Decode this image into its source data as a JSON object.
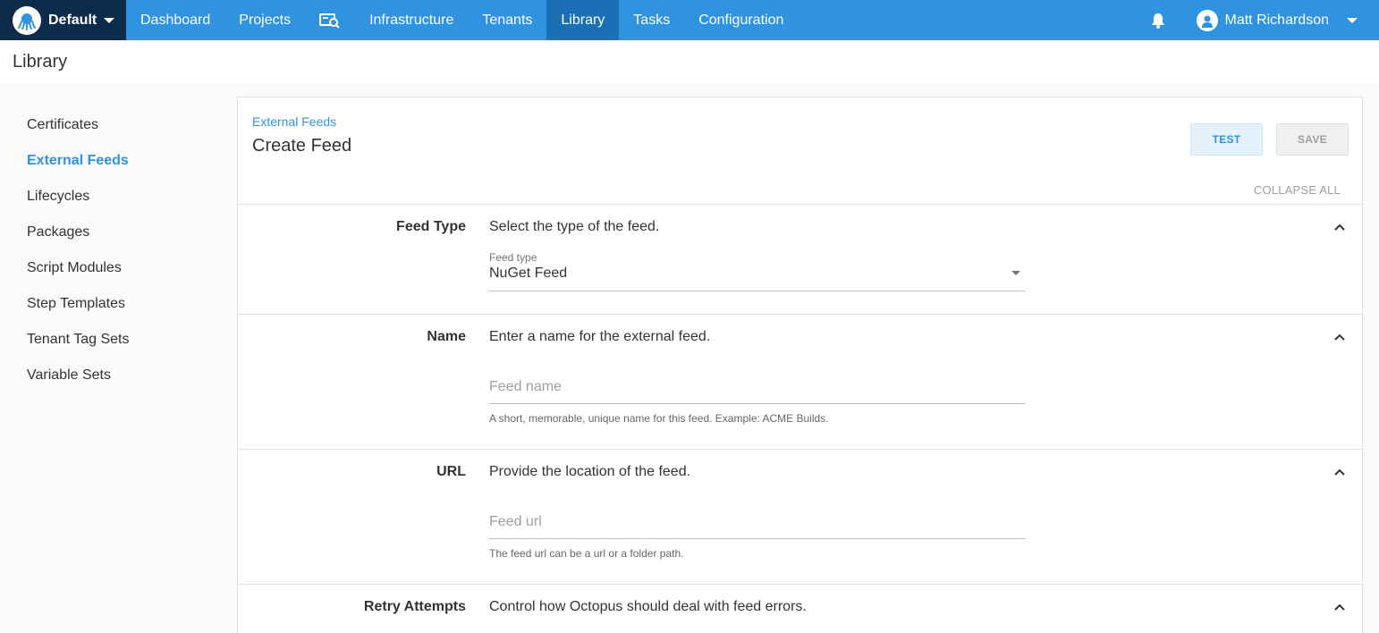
{
  "nav": {
    "space": "Default",
    "items": [
      "Dashboard",
      "Projects",
      "Infrastructure",
      "Tenants",
      "Library",
      "Tasks",
      "Configuration"
    ],
    "active": "Library",
    "user": "Matt Richardson",
    "colors": {
      "bar": "#2f93e0",
      "active": "#1a6fb5",
      "space_bg": "#0d2b4a"
    }
  },
  "page": {
    "title": "Library"
  },
  "sidebar": {
    "items": [
      {
        "label": "Certificates"
      },
      {
        "label": "External Feeds"
      },
      {
        "label": "Lifecycles"
      },
      {
        "label": "Packages"
      },
      {
        "label": "Script Modules"
      },
      {
        "label": "Step Templates"
      },
      {
        "label": "Tenant Tag Sets"
      },
      {
        "label": "Variable Sets"
      }
    ],
    "active": "External Feeds"
  },
  "form": {
    "breadcrumb": "External Feeds",
    "title": "Create Feed",
    "test_label": "TEST",
    "save_label": "SAVE",
    "collapse_all": "COLLAPSE ALL",
    "sections": {
      "feed_type": {
        "label": "Feed Type",
        "description": "Select the type of the feed.",
        "caption": "Feed type",
        "value": "NuGet Feed"
      },
      "name": {
        "label": "Name",
        "description": "Enter a name for the external feed.",
        "placeholder": "Feed name",
        "hint": "A short, memorable, unique name for this feed. Example: ACME Builds."
      },
      "url": {
        "label": "URL",
        "description": "Provide the location of the feed.",
        "placeholder": "Feed url",
        "hint": "The feed url can be a url or a folder path."
      },
      "retry": {
        "label": "Retry Attempts",
        "description": "Control how Octopus should deal with feed errors."
      }
    }
  }
}
